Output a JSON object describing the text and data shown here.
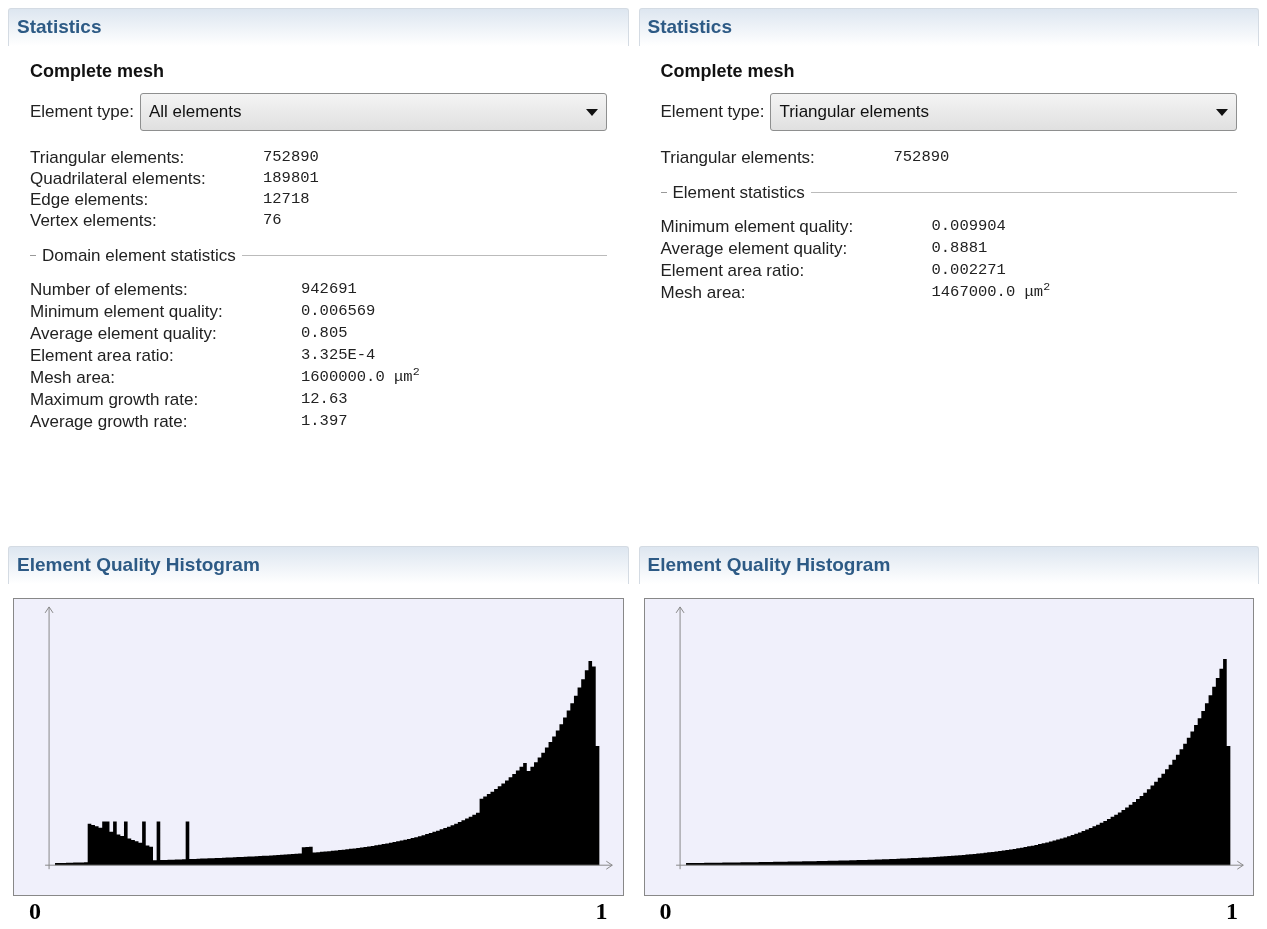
{
  "panels": [
    {
      "header": "Statistics",
      "mesh_title": "Complete mesh",
      "element_type": {
        "label": "Element type:",
        "value": "All elements"
      },
      "counts": [
        {
          "label": "Triangular elements:",
          "value": "752890"
        },
        {
          "label": "Quadrilateral elements:",
          "value": "189801"
        },
        {
          "label": "Edge elements:",
          "value": "12718"
        },
        {
          "label": "Vertex elements:",
          "value": "76"
        }
      ],
      "group": {
        "title": "Domain element statistics",
        "rows": [
          {
            "label": "Number of elements:",
            "value": "942691"
          },
          {
            "label": "Minimum element quality:",
            "value": "0.006569"
          },
          {
            "label": "Average element quality:",
            "value": "0.805"
          },
          {
            "label": "Element area ratio:",
            "value": "3.325E-4"
          },
          {
            "label": "Mesh area:",
            "value": "1600000.0 μm$^{2}$"
          },
          {
            "label": "Maximum growth rate:",
            "value": "12.63"
          },
          {
            "label": "Average growth rate:",
            "value": "1.397"
          }
        ]
      },
      "histogram": {
        "header": "Element Quality Histogram",
        "kind": "mixed",
        "x_min_label": "0",
        "x_max_label": "1"
      }
    },
    {
      "header": "Statistics",
      "mesh_title": "Complete mesh",
      "element_type": {
        "label": "Element type:",
        "value": "Triangular elements"
      },
      "counts": [
        {
          "label": "Triangular elements:",
          "value": "752890"
        }
      ],
      "group": {
        "title": "Element statistics",
        "rows": [
          {
            "label": "Minimum element quality:",
            "value": "0.009904"
          },
          {
            "label": "Average element quality:",
            "value": "0.8881"
          },
          {
            "label": "Element area ratio:",
            "value": "0.002271"
          },
          {
            "label": "Mesh area:",
            "value": "1467000.0 μm$^{2}$"
          }
        ]
      },
      "histogram": {
        "header": "Element Quality Histogram",
        "kind": "triangular",
        "x_min_label": "0",
        "x_max_label": "1"
      }
    }
  ]
}
